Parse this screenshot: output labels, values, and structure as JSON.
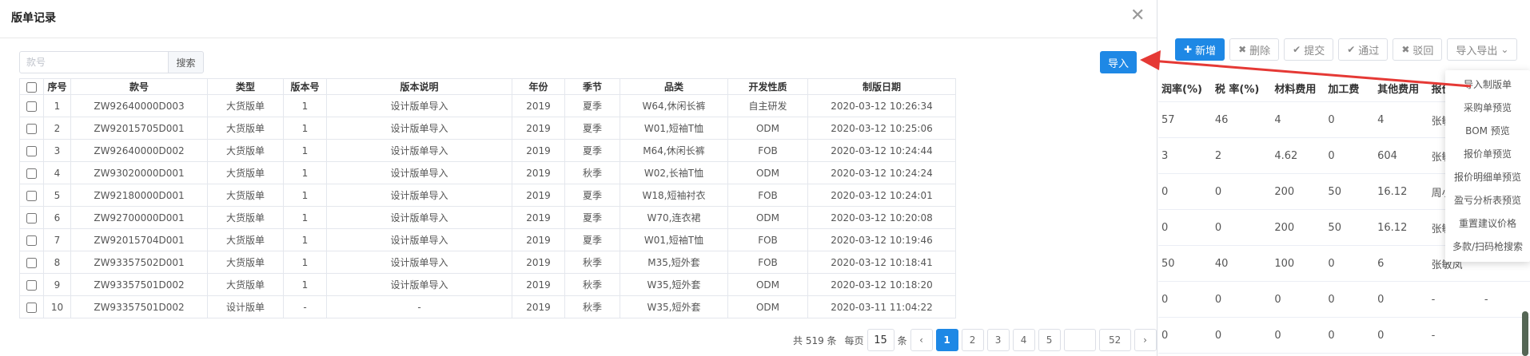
{
  "modal": {
    "title": "版单记录",
    "search_placeholder": "款号",
    "search_button": "搜索",
    "import_button": "导入"
  },
  "table": {
    "columns": [
      "序号",
      "款号",
      "类型",
      "版本号",
      "版本说明",
      "年份",
      "季节",
      "品类",
      "开发性质",
      "制版日期"
    ],
    "rows": [
      [
        "1",
        "ZW92640000D003",
        "大货版单",
        "1",
        "设计版单导入",
        "2019",
        "夏季",
        "W64,休闲长裤",
        "自主研发",
        "2020-03-12 10:26:34"
      ],
      [
        "2",
        "ZW92015705D001",
        "大货版单",
        "1",
        "设计版单导入",
        "2019",
        "夏季",
        "W01,短袖T恤",
        "ODM",
        "2020-03-12 10:25:06"
      ],
      [
        "3",
        "ZW92640000D002",
        "大货版单",
        "1",
        "设计版单导入",
        "2019",
        "夏季",
        "M64,休闲长裤",
        "FOB",
        "2020-03-12 10:24:44"
      ],
      [
        "4",
        "ZW93020000D001",
        "大货版单",
        "1",
        "设计版单导入",
        "2019",
        "秋季",
        "W02,长袖T恤",
        "ODM",
        "2020-03-12 10:24:24"
      ],
      [
        "5",
        "ZW92180000D001",
        "大货版单",
        "1",
        "设计版单导入",
        "2019",
        "夏季",
        "W18,短袖衬衣",
        "FOB",
        "2020-03-12 10:24:01"
      ],
      [
        "6",
        "ZW92700000D001",
        "大货版单",
        "1",
        "设计版单导入",
        "2019",
        "夏季",
        "W70,连衣裙",
        "ODM",
        "2020-03-12 10:20:08"
      ],
      [
        "7",
        "ZW92015704D001",
        "大货版单",
        "1",
        "设计版单导入",
        "2019",
        "夏季",
        "W01,短袖T恤",
        "FOB",
        "2020-03-12 10:19:46"
      ],
      [
        "8",
        "ZW93357502D001",
        "大货版单",
        "1",
        "设计版单导入",
        "2019",
        "秋季",
        "M35,短外套",
        "FOB",
        "2020-03-12 10:18:41"
      ],
      [
        "9",
        "ZW93357501D002",
        "大货版单",
        "1",
        "设计版单导入",
        "2019",
        "秋季",
        "W35,短外套",
        "ODM",
        "2020-03-12 10:18:20"
      ],
      [
        "10",
        "ZW93357501D002",
        "设计版单",
        "-",
        "-",
        "2019",
        "秋季",
        "W35,短外套",
        "ODM",
        "2020-03-11 11:04:22"
      ]
    ]
  },
  "pagination": {
    "total_text": "共 519 条",
    "per_page_label": "每页",
    "page_size": "15",
    "unit": "条",
    "prev": "‹",
    "next": "›",
    "pages": [
      "1",
      "2",
      "3",
      "4",
      "5"
    ],
    "ellipsis": "",
    "last_page": "52",
    "current": "1"
  },
  "background": {
    "toolbar": [
      {
        "icon": "plus-icon",
        "glyph": "✚",
        "label": "新增",
        "primary": true
      },
      {
        "icon": "x-icon",
        "glyph": "✖",
        "label": "删除"
      },
      {
        "icon": "check-icon",
        "glyph": "✔",
        "label": "提交"
      },
      {
        "icon": "check-icon",
        "glyph": "✔",
        "label": "通过"
      },
      {
        "icon": "x-icon",
        "glyph": "✖",
        "label": "驳回"
      },
      {
        "icon": "chevron-down-icon",
        "glyph": "⌄",
        "label": "导入导出"
      }
    ],
    "columns": [
      "润率(%)",
      "税 率(%)",
      "材料费用",
      "加工费",
      "其他费用",
      "报价人",
      ""
    ],
    "rows": [
      [
        "57",
        "46",
        "4",
        "0",
        "4",
        "张敏凤",
        ""
      ],
      [
        "3",
        "2",
        "4.62",
        "0",
        "604",
        "张敏凤",
        ""
      ],
      [
        "0",
        "0",
        "200",
        "50",
        "16.12",
        "周小雪",
        ""
      ],
      [
        "0",
        "0",
        "200",
        "50",
        "16.12",
        "张敏凤",
        ""
      ],
      [
        "50",
        "40",
        "100",
        "0",
        "6",
        "张敏凤",
        ""
      ],
      [
        "0",
        "0",
        "0",
        "0",
        "0",
        "-",
        "-"
      ],
      [
        "0",
        "0",
        "0",
        "0",
        "0",
        "-",
        ""
      ]
    ],
    "dropdown": [
      "导入制版单",
      "采购单预览",
      "BOM 预览",
      "报价单预览",
      "报价明细单预览",
      "盈亏分析表预览",
      "重置建议价格",
      "多款/扫码枪搜索"
    ]
  },
  "colors": {
    "primary": "#1e88e5",
    "annotation_arrow": "#e53935"
  }
}
